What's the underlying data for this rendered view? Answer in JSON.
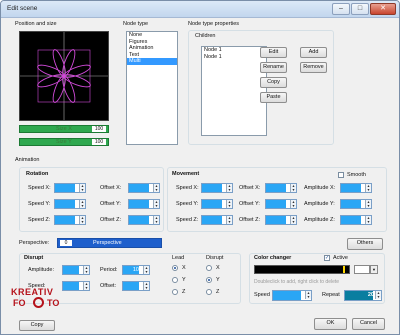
{
  "window": {
    "title": "Edit scene",
    "min": "–",
    "max": "□",
    "close": "✕"
  },
  "position": {
    "section_label": "Position and size",
    "size_x_label": "Size X",
    "size_x_value": "100",
    "size_y_label": "Size Y",
    "size_y_value": "100"
  },
  "node_type": {
    "label": "Node type",
    "options": [
      "None",
      "Figures",
      "Animation",
      "Text",
      "Multi"
    ],
    "selected": "Multi"
  },
  "node_props": {
    "label": "Node type properties",
    "children_label": "Children",
    "children": [
      "Node 1",
      "Node 1"
    ],
    "buttons": {
      "edit": "Edit",
      "add": "Add",
      "rename": "Rename",
      "remove": "Remove",
      "copy": "Copy",
      "paste": "Paste"
    }
  },
  "animation": {
    "label": "Animation",
    "rotation": {
      "label": "Rotation",
      "speed_x": "Speed X:",
      "speed_y": "Speed Y:",
      "speed_z": "Speed Z:",
      "offset_x": "Offset X:",
      "offset_y": "Offset Y:",
      "offset_z": "Offset Z:",
      "value": "0"
    },
    "movement": {
      "label": "Movement",
      "smooth_label": "Smooth",
      "speed_x": "Speed X:",
      "speed_y": "Speed Y:",
      "speed_z": "Speed Z:",
      "offset_x": "Offset X:",
      "offset_y": "Offset Y:",
      "offset_z": "Offset Z:",
      "amp_x": "Amplitude X:",
      "amp_y": "Amplitude Y:",
      "amp_z": "Amplitude Z:",
      "value": "0"
    },
    "perspective_label": "Perspective:",
    "perspective_value": "0",
    "perspective_bar": "Perspective",
    "others_button": "Others"
  },
  "disrupt": {
    "label": "Disrupt",
    "amplitude_label": "Amplitude:",
    "amplitude_value": "0",
    "period_label": "Period:",
    "period_value": "100",
    "speed_label": "Speed:",
    "offset_label": "Offset:",
    "offset_value": "0",
    "lead_label": "Lead",
    "disrupt_label": "Disrupt",
    "axes": [
      "X",
      "Y",
      "Z"
    ],
    "lead_selected": "X",
    "disrupt_selected": "Y"
  },
  "color_changer": {
    "label": "Color changer",
    "active_label": "Active",
    "hint": "Doubleclick to add, right click to delete",
    "speed_label": "Speed",
    "repeat_label": "Repeat",
    "repeat_value": "20"
  },
  "footer": {
    "copy_button": "Copy",
    "ok_button": "OK",
    "cancel_button": "Cancel"
  },
  "watermark": {
    "line1": "KREATIV",
    "line2a": "FO",
    "line2b": "TO"
  },
  "colors": {
    "accent": "#2aa6f5",
    "selection": "#3399ff",
    "green": "#2fa84f"
  }
}
